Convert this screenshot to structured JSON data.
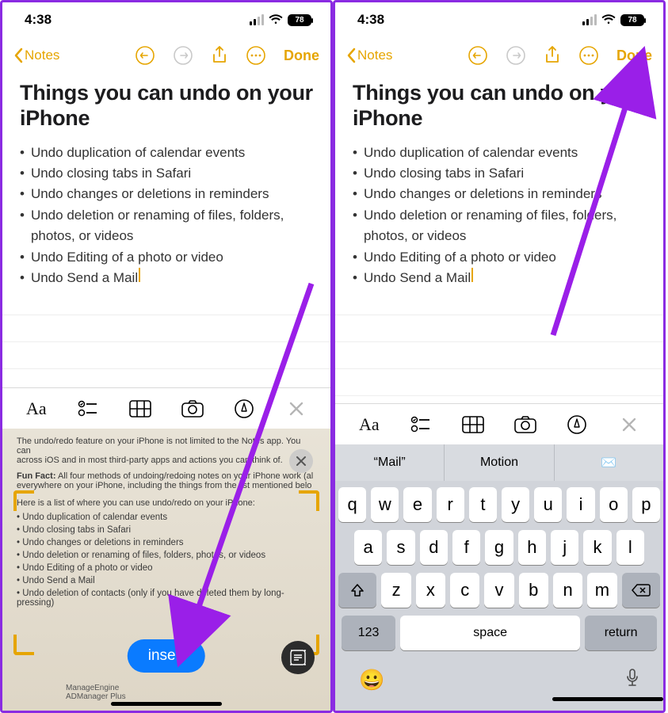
{
  "status": {
    "time": "4:38",
    "battery": "78"
  },
  "nav": {
    "back": "Notes",
    "done": "Done"
  },
  "note": {
    "title": "Things you can undo on your iPhone",
    "bullets": [
      "Undo duplication of calendar events",
      "Undo closing tabs in Safari",
      "Undo changes or deletions in reminders",
      "Undo deletion or renaming of files, folders, photos, or videos",
      "Undo Editing of a photo or video",
      "Undo Send a Mail"
    ]
  },
  "scanner": {
    "line1": "The undo/redo feature on your iPhone is not limited to the Notes app. You can",
    "line2": "across iOS and in most third-party apps and actions you can think of.",
    "funfact_label": "Fun Fact:",
    "funfact": "All four methods of undoing/redoing notes on your iPhone work (al everywhere on your iPhone, including the things from the list mentioned belo",
    "listintro": "Here is a list of where you can use undo/redo on your iPhone:",
    "items": [
      "Undo duplication of calendar events",
      "Undo closing tabs in Safari",
      "Undo changes or deletions in reminders",
      "Undo deletion or renaming of files, folders, photos, or videos",
      "Undo Editing of a photo or video",
      "Undo Send a Mail",
      "Undo deletion of contacts (only if you have deleted them by long-pressing)"
    ],
    "ad1": "ManageEngine",
    "ad2": "ADManager Plus",
    "insert": "insert"
  },
  "keyboard": {
    "suggestions": [
      "“Mail”",
      "Motion",
      ""
    ],
    "row1": [
      "q",
      "w",
      "e",
      "r",
      "t",
      "y",
      "u",
      "i",
      "o",
      "p"
    ],
    "row2": [
      "a",
      "s",
      "d",
      "f",
      "g",
      "h",
      "j",
      "k",
      "l"
    ],
    "row3": [
      "z",
      "x",
      "c",
      "v",
      "b",
      "n",
      "m"
    ],
    "num": "123",
    "space": "space",
    "ret": "return"
  }
}
